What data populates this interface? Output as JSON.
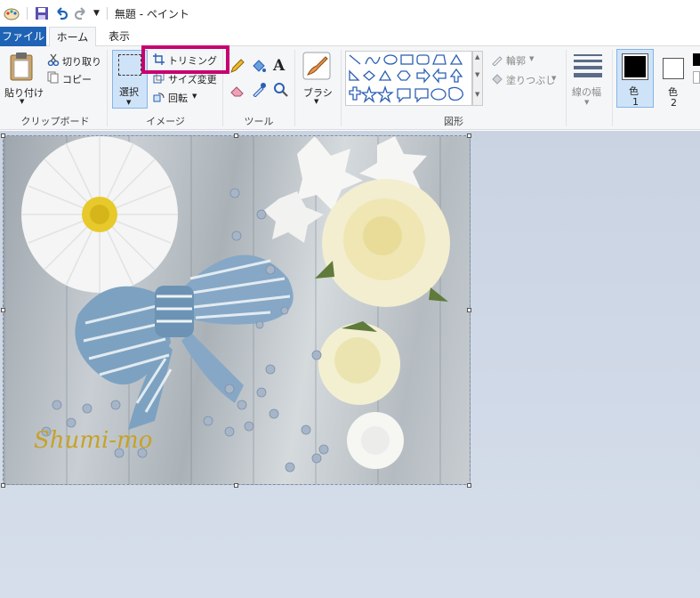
{
  "title_bar": {
    "title": "無題 - ペイント"
  },
  "tabs": {
    "file": "ファイル",
    "home": "ホーム",
    "view": "表示"
  },
  "clipboard": {
    "paste": "貼り付け",
    "cut": "切り取り",
    "copy": "コピー",
    "group": "クリップボード"
  },
  "image": {
    "select": "選択",
    "crop": "トリミング",
    "resize": "サイズ変更",
    "rotate": "回転",
    "group": "イメージ"
  },
  "tools": {
    "group": "ツール",
    "text_glyph": "A"
  },
  "brushes": {
    "label": "ブラシ"
  },
  "shapes": {
    "outline": "輪郭",
    "fill": "塗りつぶし",
    "group": "図形"
  },
  "size": {
    "label": "線の幅"
  },
  "colors": {
    "color1_label": "色",
    "color1_num": "1",
    "color2_label": "色",
    "color2_num": "2",
    "color1": "#000000",
    "color2": "#ffffff"
  },
  "canvas": {
    "watermark": "Shumi-mo"
  },
  "accent": {
    "file_tab": "#1e63b5",
    "highlight": "#c7006f"
  }
}
